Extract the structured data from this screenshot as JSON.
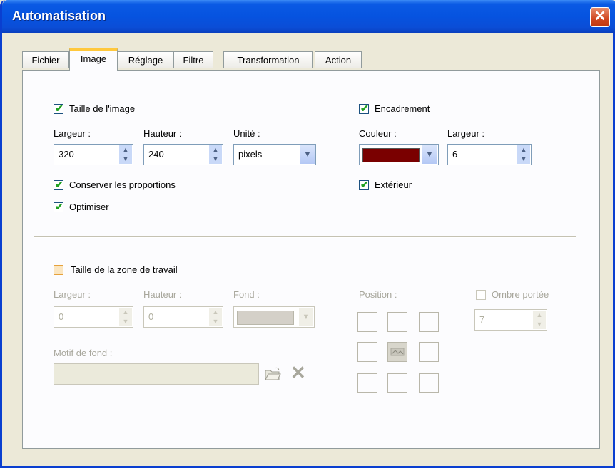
{
  "window": {
    "title": "Automatisation",
    "close_glyph": "✕"
  },
  "tabs": [
    {
      "label": "Fichier"
    },
    {
      "label": "Image"
    },
    {
      "label": "Réglage"
    },
    {
      "label": "Filtre"
    },
    {
      "label": "Transformation"
    },
    {
      "label": "Action"
    }
  ],
  "image_size": {
    "checkbox_label": "Taille de l'image",
    "checked": true,
    "width_label": "Largeur :",
    "width_value": "320",
    "height_label": "Hauteur :",
    "height_value": "240",
    "unit_label": "Unité :",
    "unit_value": "pixels",
    "keep_proportions_label": "Conserver les proportions",
    "keep_proportions_checked": true,
    "optimize_label": "Optimiser",
    "optimize_checked": true
  },
  "frame": {
    "checkbox_label": "Encadrement",
    "checked": true,
    "color_label": "Couleur :",
    "color_value": "#7a0000",
    "width_label": "Largeur :",
    "width_value": "6",
    "outside_label": "Extérieur",
    "outside_checked": true
  },
  "workspace": {
    "checkbox_label": "Taille de la zone de travail",
    "checked": false,
    "width_label": "Largeur :",
    "width_value": "0",
    "height_label": "Hauteur :",
    "height_value": "0",
    "background_label": "Fond :",
    "background_color": "#d4d0c8",
    "position_label": "Position :",
    "shadow_label": "Ombre portée",
    "shadow_checked": false,
    "shadow_value": "7",
    "pattern_label": "Motif de fond :",
    "pattern_value": ""
  },
  "colors": {
    "accent_tab": "#ffc83c",
    "titlebar": "#0653e0",
    "check": "#21a121"
  }
}
